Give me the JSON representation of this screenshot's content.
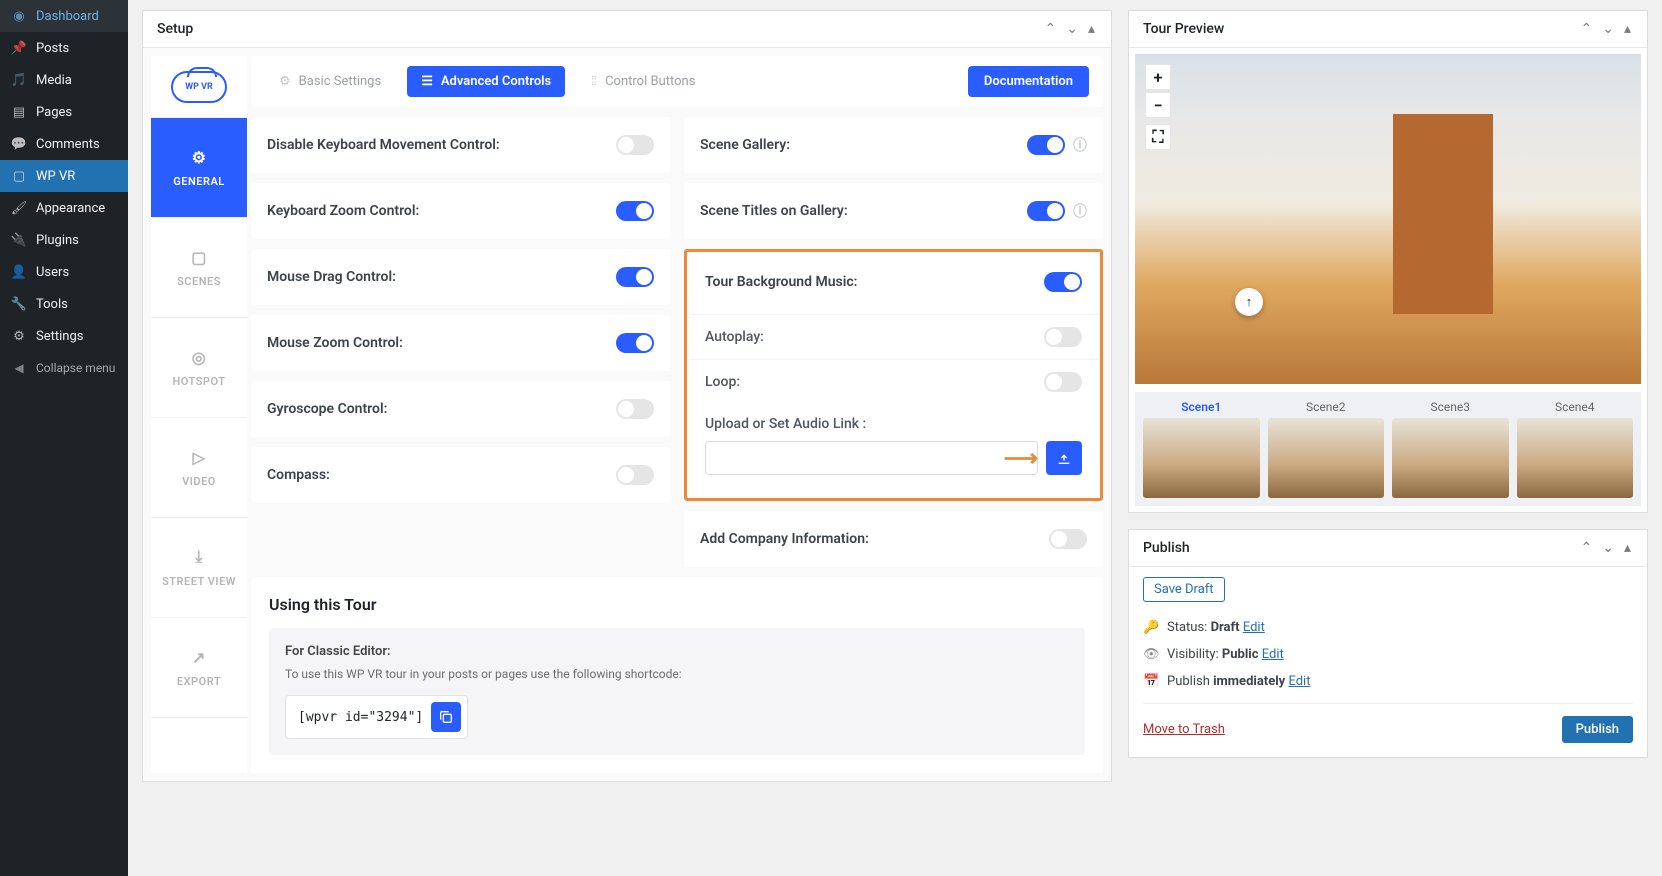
{
  "sidebar": {
    "items": [
      {
        "label": "Dashboard",
        "icon": "dashboard"
      },
      {
        "label": "Posts",
        "icon": "pin"
      },
      {
        "label": "Media",
        "icon": "media"
      },
      {
        "label": "Pages",
        "icon": "pages"
      },
      {
        "label": "Comments",
        "icon": "comment"
      },
      {
        "label": "WP VR",
        "icon": "vr"
      },
      {
        "label": "Appearance",
        "icon": "brush"
      },
      {
        "label": "Plugins",
        "icon": "plug"
      },
      {
        "label": "Users",
        "icon": "user"
      },
      {
        "label": "Tools",
        "icon": "tool"
      },
      {
        "label": "Settings",
        "icon": "settings"
      }
    ],
    "collapse": "Collapse menu"
  },
  "setup": {
    "title": "Setup",
    "logo_text": "WP VR",
    "vtabs": [
      {
        "label": "GENERAL",
        "icon": "gear"
      },
      {
        "label": "SCENES",
        "icon": "image"
      },
      {
        "label": "HOTSPOT",
        "icon": "target"
      },
      {
        "label": "VIDEO",
        "icon": "video"
      },
      {
        "label": "STREET VIEW",
        "icon": "pin"
      },
      {
        "label": "EXPORT",
        "icon": "export"
      }
    ],
    "htabs": {
      "basic": "Basic Settings",
      "advanced": "Advanced Controls",
      "control_buttons": "Control Buttons"
    },
    "documentation": "Documentation",
    "controls_left": [
      {
        "label": "Disable Keyboard Movement Control:",
        "on": false
      },
      {
        "label": "Keyboard Zoom Control:",
        "on": true
      },
      {
        "label": "Mouse Drag Control:",
        "on": true
      },
      {
        "label": "Mouse Zoom Control:",
        "on": true
      },
      {
        "label": "Gyroscope Control:",
        "on": false
      },
      {
        "label": "Compass:",
        "on": false
      }
    ],
    "controls_right_top": [
      {
        "label": "Scene Gallery:",
        "on": true,
        "info": true
      },
      {
        "label": "Scene Titles on Gallery:",
        "on": true,
        "info": true
      }
    ],
    "music": {
      "label": "Tour Background Music:",
      "on": true,
      "autoplay": "Autoplay:",
      "autoplay_on": false,
      "loop": "Loop:",
      "loop_on": false,
      "upload_label": "Upload or Set Audio Link :",
      "value": ""
    },
    "company": {
      "label": "Add Company Information:",
      "on": false
    },
    "using": {
      "title": "Using this Tour",
      "subtitle": "For Classic Editor:",
      "desc": "To use this WP VR tour in your posts or pages use the following shortcode:",
      "shortcode": "[wpvr id=\"3294\"]"
    }
  },
  "preview": {
    "title": "Tour Preview",
    "thumbs": [
      "Scene1",
      "Scene2",
      "Scene3",
      "Scene4"
    ]
  },
  "publish": {
    "title": "Publish",
    "save_draft": "Save Draft",
    "status_label": "Status:",
    "status_value": "Draft",
    "visibility_label": "Visibility:",
    "visibility_value": "Public",
    "publish_label": "Publish",
    "publish_value": "immediately",
    "edit": "Edit",
    "trash": "Move to Trash",
    "publish_btn": "Publish"
  }
}
